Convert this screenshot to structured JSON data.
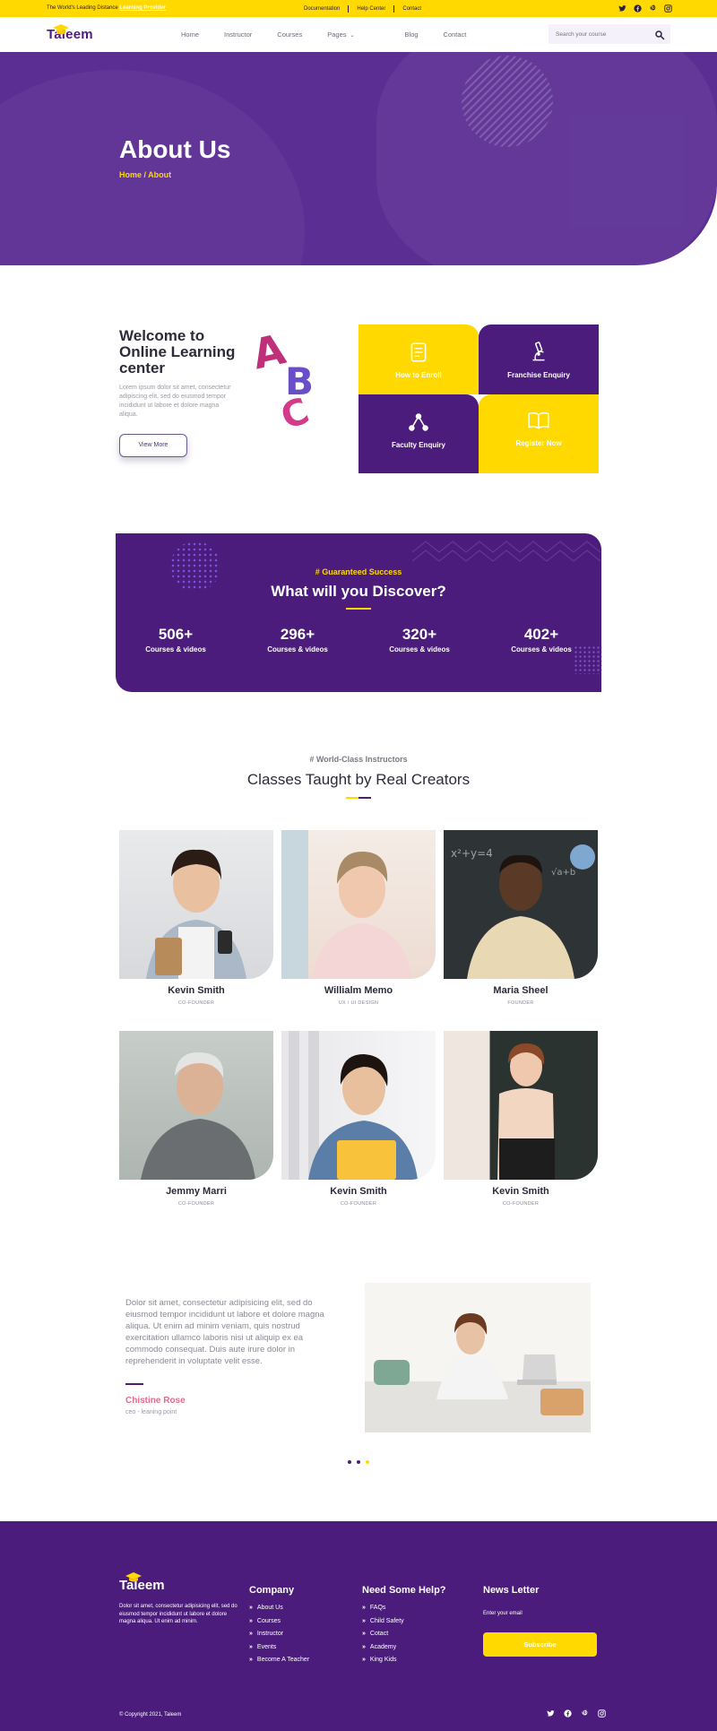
{
  "topbar": {
    "tagline": "The World's Leading Distance",
    "tagline_link": "Learning Provider",
    "links": [
      "Documentation",
      "Help Center",
      "Contact"
    ],
    "social_icons": [
      "twitter-icon",
      "facebook-icon",
      "pinterest-icon",
      "instagram-icon"
    ]
  },
  "nav": {
    "logo": "Taleem",
    "links": [
      "Home",
      "Instructor",
      "Courses",
      "Pages",
      "Blog",
      "Contact"
    ],
    "search_placeholder": "Search your course"
  },
  "hero": {
    "title": "About Us",
    "breadcrumb": "Home / About"
  },
  "welcome": {
    "title": "Welcome to Online Learning center",
    "text": "Lorem ipsum dolor sit amet, consectetur adipiscing elit, sed do eiusmod tempor incididunt ut labore et dolore magna aliqua.",
    "button": "View More",
    "tiles": [
      {
        "label": "How to Enroll",
        "icon": "document-icon"
      },
      {
        "label": "Franchise Enquiry",
        "icon": "microscope-icon"
      },
      {
        "label": "Faculty Enquiry",
        "icon": "network-icon"
      },
      {
        "label": "Register Now",
        "icon": "book-icon"
      }
    ]
  },
  "discover": {
    "kicker": "# Guaranteed Success",
    "title": "What will you Discover?",
    "stats": [
      {
        "num": "506+",
        "label": "Courses & videos"
      },
      {
        "num": "296+",
        "label": "Courses & videos"
      },
      {
        "num": "320+",
        "label": "Courses & videos"
      },
      {
        "num": "402+",
        "label": "Courses & videos"
      }
    ]
  },
  "instructors": {
    "kicker": "# World-Class Instructors",
    "title": "Classes Taught by Real Creators",
    "people": [
      {
        "name": "Kevin Smith",
        "role": "CO-FOUNDER"
      },
      {
        "name": "Willialm Memo",
        "role": "UX / UI DESIGN"
      },
      {
        "name": "Maria Sheel",
        "role": "FOUNDER"
      },
      {
        "name": "Jemmy Marri",
        "role": "CO-FOUNDER"
      },
      {
        "name": "Kevin Smith",
        "role": "CO-FOUNDER"
      },
      {
        "name": "Kevin Smith",
        "role": "CO-FOUNDER"
      }
    ]
  },
  "testimonial": {
    "quote": "Dolor sit amet, consectetur adipisicing elit, sed do eiusmod tempor incididunt ut labore et dolore magna aliqua. Ut enim ad minim veniam, quis nostrud exercitation ullamco laboris nisi ut aliquip ex ea commodo consequat. Duis aute irure dolor in reprehenderit in voluptate velit esse.",
    "name": "Chistine Rose",
    "role": "ceo - leaning point"
  },
  "footer": {
    "logo": "Taleem",
    "desc": "Dolor sit amet, consectetur adipisicing elit, sed do eiusmod tempor incididunt ut labore et dolore magna aliqua. Ut enim ad minim.",
    "company_title": "Company",
    "company_links": [
      "About Us",
      "Courses",
      "Instructor",
      "Events",
      "Become A Teacher"
    ],
    "help_title": "Need Some Help?",
    "help_links": [
      "FAQs",
      "Child Safety",
      "Cotact",
      "Academy",
      "King Kids"
    ],
    "news_title": "News Letter",
    "news_label": "Enter your email",
    "subscribe": "Subscribe",
    "copyright": "© Copyright 2021, Taleem"
  },
  "colors": {
    "yellow": "#ffd900",
    "purple": "#4b1c7c",
    "hero": "#5b2e93",
    "accent_pink": "#e26a8a"
  }
}
